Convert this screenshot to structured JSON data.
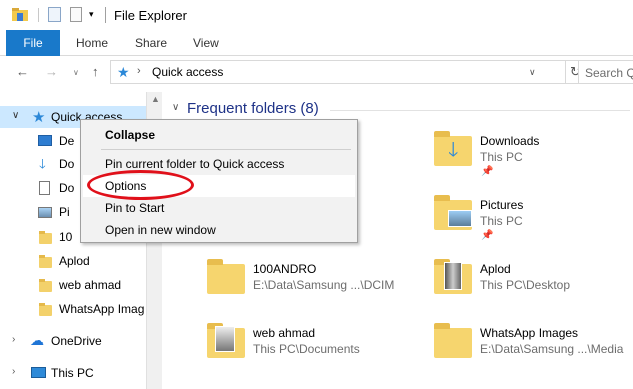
{
  "window": {
    "title": "File Explorer"
  },
  "ribbon": {
    "tabs": [
      "File",
      "Home",
      "Share",
      "View"
    ]
  },
  "address": {
    "location": "Quick access",
    "search_placeholder": "Search Q"
  },
  "sidebar": {
    "items": [
      {
        "label": "Quick access",
        "icon": "star-icon"
      },
      {
        "label": "De",
        "icon": "desktop-icon"
      },
      {
        "label": "Do",
        "icon": "downloads-icon"
      },
      {
        "label": "Do",
        "icon": "documents-icon"
      },
      {
        "label": "Pi",
        "icon": "pictures-icon"
      },
      {
        "label": "10",
        "icon": "folder-icon"
      },
      {
        "label": "Aplod",
        "icon": "folder-icon"
      },
      {
        "label": "web ahmad",
        "icon": "folder-icon"
      },
      {
        "label": "WhatsApp Imag",
        "icon": "folder-icon"
      },
      {
        "label": "OneDrive",
        "icon": "cloud-icon"
      },
      {
        "label": "This PC",
        "icon": "computer-icon"
      }
    ]
  },
  "main": {
    "group_title": "Frequent folders (8)",
    "folders": [
      {
        "name": "Downloads",
        "path": "This PC"
      },
      {
        "name": "Pictures",
        "path": "This PC"
      },
      {
        "name": "100ANDRO",
        "path": "E:\\Data\\Samsung ...\\DCIM"
      },
      {
        "name": "Aplod",
        "path": "This PC\\Desktop"
      },
      {
        "name": "web ahmad",
        "path": "This PC\\Documents"
      },
      {
        "name": "WhatsApp Images",
        "path": "E:\\Data\\Samsung ...\\Media"
      }
    ]
  },
  "context_menu": {
    "items": [
      "Collapse",
      "Pin current folder to Quick access",
      "Options",
      "Pin to Start",
      "Open in new window"
    ]
  },
  "colors": {
    "accent": "#1979ca",
    "selection": "#cce8ff",
    "annotation": "#e0101a"
  }
}
